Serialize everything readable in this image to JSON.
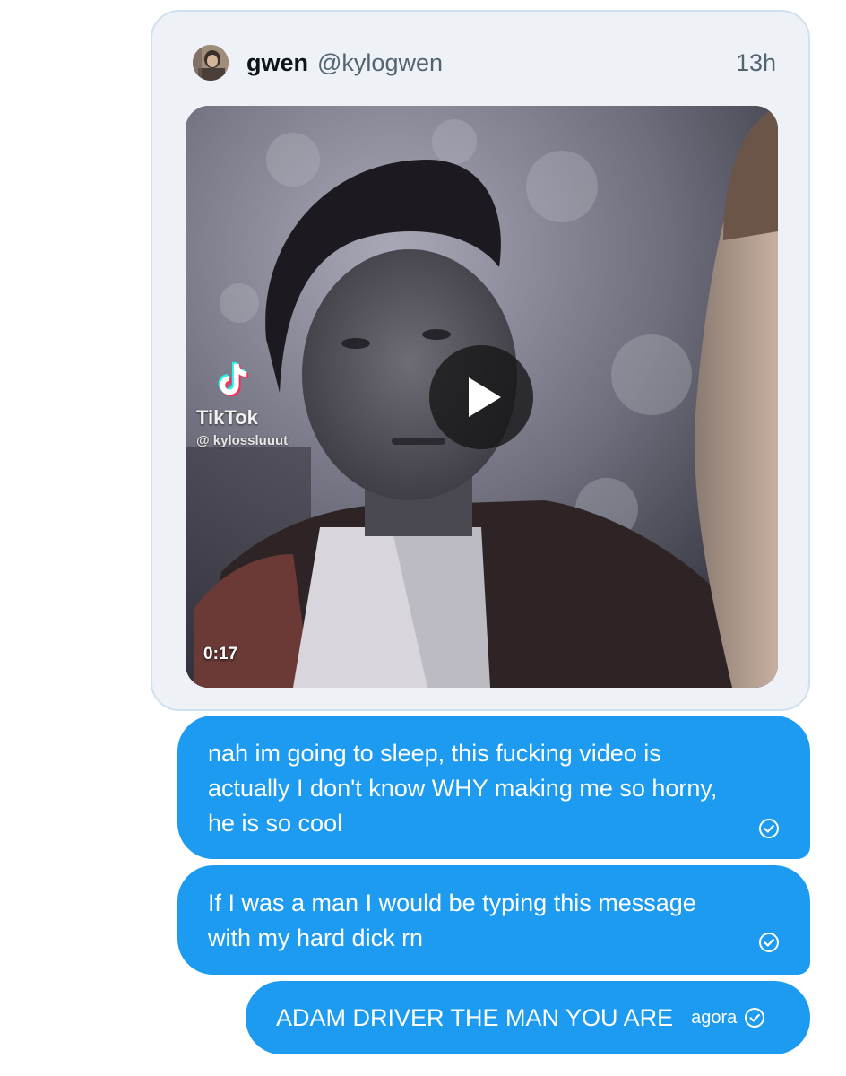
{
  "tweet": {
    "author_name": "gwen",
    "author_handle": "@kylogwen",
    "time": "13h",
    "media": {
      "kind": "video",
      "duration": "0:17",
      "watermark_brand": "TikTok",
      "watermark_user": "@ kylossluuut"
    }
  },
  "messages": [
    {
      "lines": [
        "nah im going to sleep, this fucking video is",
        "actually I don't know WHY making me so horny,",
        "he is so cool"
      ],
      "status_icon": "read-check-icon"
    },
    {
      "lines": [
        "If I was a man I would be typing this message",
        "with my hard dick rn"
      ],
      "status_icon": "read-check-icon"
    },
    {
      "text": "ADAM DRIVER THE MAN YOU ARE",
      "time": "agora",
      "status_icon": "read-check-icon"
    }
  ],
  "colors": {
    "bubble": "#1d9bf0",
    "card_background": "#eef2f6",
    "card_border": "#cfe0ee"
  }
}
